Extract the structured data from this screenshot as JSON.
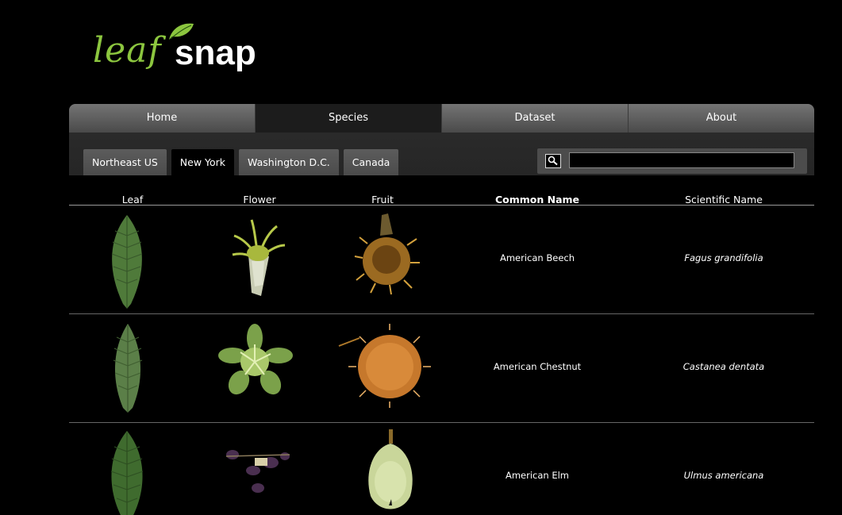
{
  "logo": {
    "leaf_text": "leaf",
    "snap_text": "snap",
    "colors": {
      "leaf": "#8cc63f",
      "snap": "#ffffff"
    }
  },
  "main_nav": {
    "items": [
      {
        "label": "Home",
        "active": false
      },
      {
        "label": "Species",
        "active": true
      },
      {
        "label": "Dataset",
        "active": false
      },
      {
        "label": "About",
        "active": false
      }
    ]
  },
  "region_tabs": {
    "items": [
      {
        "label": "Northeast US",
        "active": false
      },
      {
        "label": "New York",
        "active": true
      },
      {
        "label": "Washington D.C.",
        "active": false
      },
      {
        "label": "Canada",
        "active": false
      }
    ]
  },
  "search": {
    "value": "",
    "icon": "magnifier-icon"
  },
  "table": {
    "columns": [
      "Leaf",
      "Flower",
      "Fruit",
      "Common Name",
      "Scientific Name"
    ],
    "rows": [
      {
        "common_name": "American Beech",
        "scientific_name": "Fagus grandifolia",
        "leaf_image": "leaf-image",
        "flower_image": "flower-image",
        "fruit_image": "fruit-image"
      },
      {
        "common_name": "American Chestnut",
        "scientific_name": "Castanea dentata",
        "leaf_image": "leaf-image",
        "flower_image": "flower-image",
        "fruit_image": "fruit-image"
      },
      {
        "common_name": "American Elm",
        "scientific_name": "Ulmus americana",
        "leaf_image": "leaf-image",
        "flower_image": "flower-image",
        "fruit_image": "fruit-image"
      }
    ]
  }
}
